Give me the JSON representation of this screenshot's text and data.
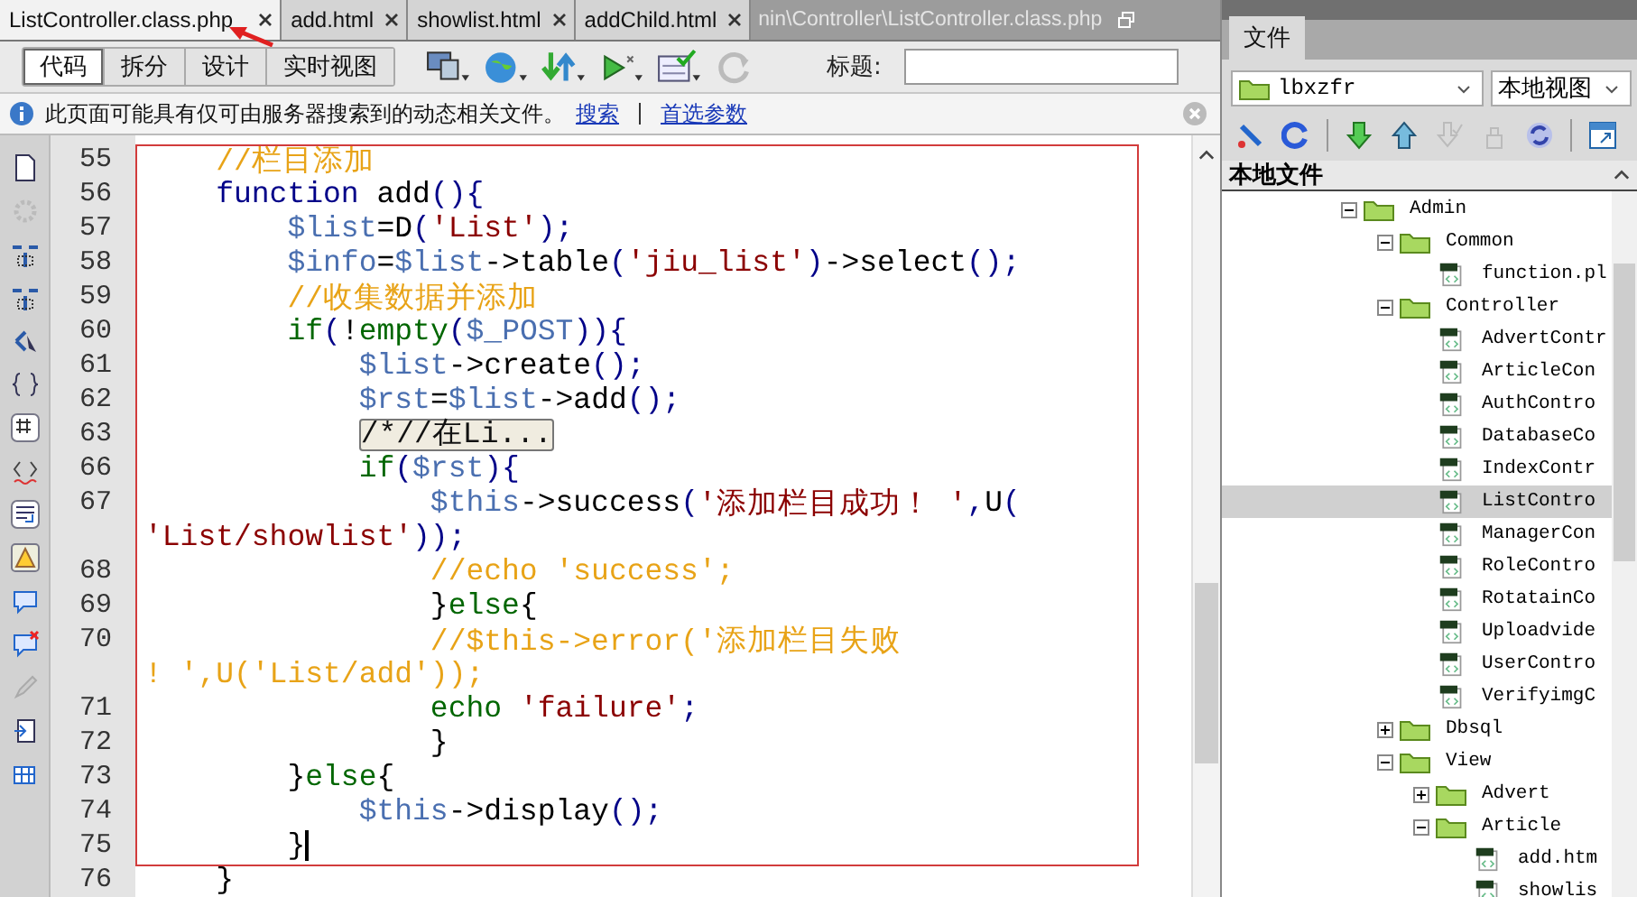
{
  "tabs": [
    {
      "label": "ListController.class.php",
      "selected": true
    },
    {
      "label": "add.html",
      "selected": false
    },
    {
      "label": "showlist.html",
      "selected": false
    },
    {
      "label": "addChild.html",
      "selected": false
    }
  ],
  "document_path": "nin\\Controller\\ListController.class.php",
  "view_buttons": [
    {
      "label": "代码",
      "selected": true
    },
    {
      "label": "拆分",
      "selected": false
    },
    {
      "label": "设计",
      "selected": false
    },
    {
      "label": "实时视图",
      "selected": false
    }
  ],
  "title_field": {
    "label": "标题:"
  },
  "info_bar": {
    "message": "此页面可能具有仅可由服务器搜索到的动态相关文件。",
    "links": [
      "搜索",
      "首选参数"
    ]
  },
  "editor": {
    "lines": [
      {
        "number": "55",
        "segments": [
          {
            "kind": "comment",
            "text": "    //栏目添加"
          }
        ]
      },
      {
        "number": "56",
        "segments": [
          {
            "kind": "keyword",
            "text": "    function"
          },
          {
            "kind": "plain",
            "text": " add"
          },
          {
            "kind": "punct",
            "text": "(){"
          }
        ]
      },
      {
        "number": "57",
        "segments": [
          {
            "kind": "var",
            "text": "        $list"
          },
          {
            "kind": "plain",
            "text": "=D"
          },
          {
            "kind": "punct",
            "text": "("
          },
          {
            "kind": "string",
            "text": "'List'"
          },
          {
            "kind": "punct",
            "text": ");"
          }
        ]
      },
      {
        "number": "58",
        "segments": [
          {
            "kind": "var",
            "text": "        $info"
          },
          {
            "kind": "plain",
            "text": "="
          },
          {
            "kind": "var",
            "text": "$list"
          },
          {
            "kind": "plain",
            "text": "->table"
          },
          {
            "kind": "punct",
            "text": "("
          },
          {
            "kind": "string",
            "text": "'jiu_list'"
          },
          {
            "kind": "punct",
            "text": ")"
          },
          {
            "kind": "plain",
            "text": "->select"
          },
          {
            "kind": "punct",
            "text": "();"
          }
        ]
      },
      {
        "number": "59",
        "segments": [
          {
            "kind": "comment",
            "text": "        //收集数据并添加"
          }
        ]
      },
      {
        "number": "60",
        "segments": [
          {
            "kind": "control",
            "text": "        if"
          },
          {
            "kind": "punct",
            "text": "("
          },
          {
            "kind": "plain",
            "text": "!"
          },
          {
            "kind": "control",
            "text": "empty"
          },
          {
            "kind": "punct",
            "text": "("
          },
          {
            "kind": "var",
            "text": "$_POST"
          },
          {
            "kind": "punct",
            "text": ")){"
          }
        ]
      },
      {
        "number": "61",
        "segments": [
          {
            "kind": "var",
            "text": "            $list"
          },
          {
            "kind": "plain",
            "text": "->create"
          },
          {
            "kind": "punct",
            "text": "();"
          }
        ]
      },
      {
        "number": "62",
        "segments": [
          {
            "kind": "var",
            "text": "            $rst"
          },
          {
            "kind": "plain",
            "text": "="
          },
          {
            "kind": "var",
            "text": "$list"
          },
          {
            "kind": "plain",
            "text": "->add"
          },
          {
            "kind": "punct",
            "text": "();"
          }
        ]
      },
      {
        "number": "63",
        "segments": [
          {
            "kind": "fold",
            "text": "            /*//在Li..."
          }
        ]
      },
      {
        "number": "66",
        "segments": [
          {
            "kind": "control",
            "text": "            if"
          },
          {
            "kind": "punct",
            "text": "("
          },
          {
            "kind": "var",
            "text": "$rst"
          },
          {
            "kind": "punct",
            "text": "){"
          }
        ]
      },
      {
        "number": "67",
        "segments": [
          {
            "kind": "var",
            "text": "                $this"
          },
          {
            "kind": "plain",
            "text": "->success"
          },
          {
            "kind": "punct",
            "text": "("
          },
          {
            "kind": "string",
            "text": "'添加栏目成功！ '"
          },
          {
            "kind": "punct",
            "text": ","
          },
          {
            "kind": "plain",
            "text": "U"
          },
          {
            "kind": "punct",
            "text": "("
          }
        ]
      },
      {
        "segments": [
          {
            "kind": "string",
            "text": "'List/showlist'"
          },
          {
            "kind": "punct",
            "text": "));"
          }
        ]
      },
      {
        "number": "68",
        "segments": [
          {
            "kind": "comment",
            "text": "                //echo 'success';"
          }
        ]
      },
      {
        "number": "69",
        "segments": [
          {
            "kind": "plain",
            "text": "                }"
          },
          {
            "kind": "control",
            "text": "else"
          },
          {
            "kind": "plain",
            "text": "{"
          }
        ]
      },
      {
        "number": "70",
        "segments": [
          {
            "kind": "comment",
            "text": "                //$this->error('添加栏目失败"
          }
        ]
      },
      {
        "segments": [
          {
            "kind": "comment",
            "text": "! ',U('List/add'));"
          }
        ]
      },
      {
        "number": "71",
        "segments": [
          {
            "kind": "control",
            "text": "                echo "
          },
          {
            "kind": "string",
            "text": "'failure'"
          },
          {
            "kind": "punct",
            "text": ";"
          }
        ]
      },
      {
        "number": "72",
        "segments": [
          {
            "kind": "plain",
            "text": "                }"
          }
        ]
      },
      {
        "number": "73",
        "segments": [
          {
            "kind": "plain",
            "text": "        }"
          },
          {
            "kind": "control",
            "text": "else"
          },
          {
            "kind": "plain",
            "text": "{"
          }
        ]
      },
      {
        "number": "74",
        "segments": [
          {
            "kind": "var",
            "text": "            $this"
          },
          {
            "kind": "plain",
            "text": "->display"
          },
          {
            "kind": "punct",
            "text": "();"
          }
        ]
      },
      {
        "number": "75",
        "cursor": true,
        "segments": [
          {
            "kind": "plain",
            "text": "        }"
          }
        ]
      },
      {
        "number": "76",
        "segments": [
          {
            "kind": "plain",
            "text": "    }"
          }
        ]
      }
    ]
  },
  "files_panel": {
    "tab": "文件",
    "site": "lbxzfr",
    "view": "本地视图",
    "header": "本地文件",
    "tree": [
      {
        "kind": "folder",
        "label": "Admin",
        "expanded": true,
        "selected": false,
        "children": [
          {
            "kind": "folder",
            "label": "Common",
            "expanded": true,
            "selected": false,
            "children": [
              {
                "kind": "file",
                "label": "function.pl",
                "selected": false
              }
            ]
          },
          {
            "kind": "folder",
            "label": "Controller",
            "expanded": true,
            "selected": false,
            "children": [
              {
                "kind": "file",
                "label": "AdvertContr",
                "selected": false
              },
              {
                "kind": "file",
                "label": "ArticleCon",
                "selected": false
              },
              {
                "kind": "file",
                "label": "AuthContro",
                "selected": false
              },
              {
                "kind": "file",
                "label": "DatabaseCo",
                "selected": false
              },
              {
                "kind": "file",
                "label": "IndexContr",
                "selected": false
              },
              {
                "kind": "file",
                "label": "ListContro",
                "selected": true
              },
              {
                "kind": "file",
                "label": "ManagerCon",
                "selected": false
              },
              {
                "kind": "file",
                "label": "RoleContro",
                "selected": false
              },
              {
                "kind": "file",
                "label": "RotatainCo",
                "selected": false
              },
              {
                "kind": "file",
                "label": "Uploadvide",
                "selected": false
              },
              {
                "kind": "file",
                "label": "UserContro",
                "selected": false
              },
              {
                "kind": "file",
                "label": "VerifyimgC",
                "selected": false
              }
            ]
          },
          {
            "kind": "folder",
            "label": "Dbsql",
            "expanded": false,
            "selected": false
          },
          {
            "kind": "folder",
            "label": "View",
            "expanded": true,
            "selected": false,
            "children": [
              {
                "kind": "folder",
                "label": "Advert",
                "expanded": false,
                "selected": false
              },
              {
                "kind": "folder",
                "label": "Article",
                "expanded": true,
                "selected": false,
                "children": [
                  {
                    "kind": "file",
                    "label": "add.htm",
                    "selected": false
                  },
                  {
                    "kind": "file",
                    "label": "showlis",
                    "selected": false
                  }
                ]
              }
            ]
          }
        ]
      }
    ]
  }
}
